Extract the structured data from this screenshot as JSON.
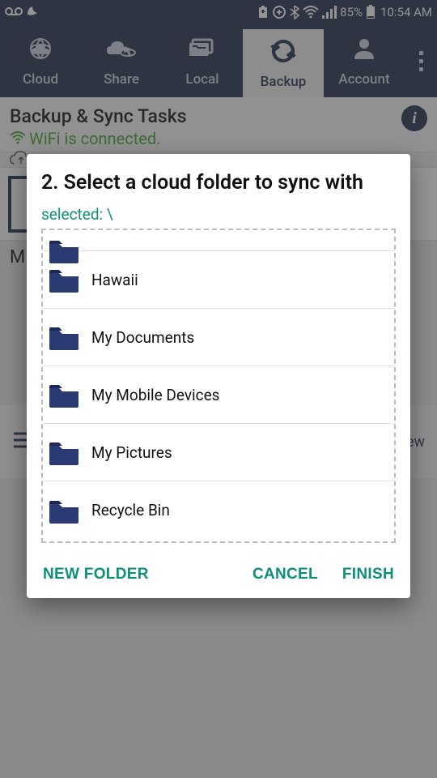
{
  "status": {
    "battery": "85%",
    "time": "10:54 AM"
  },
  "nav": {
    "tabs": [
      {
        "label": "Cloud"
      },
      {
        "label": "Share"
      },
      {
        "label": "Local"
      },
      {
        "label": "Backup"
      },
      {
        "label": "Account"
      }
    ],
    "active_index": 3
  },
  "page": {
    "title": "Backup & Sync Tasks",
    "wifi_status": "WiFi is connected."
  },
  "bg": {
    "row_letter": "M",
    "strip_text": "ew"
  },
  "dialog": {
    "title": "2. Select a cloud folder to sync with",
    "selected_prefix": "selected: ",
    "selected_path": "\\",
    "folders": [
      {
        "name": "Hawaii"
      },
      {
        "name": "My Documents"
      },
      {
        "name": "My Mobile Devices"
      },
      {
        "name": "My Pictures"
      },
      {
        "name": "Recycle Bin"
      }
    ],
    "buttons": {
      "new_folder": "NEW FOLDER",
      "cancel": "CANCEL",
      "finish": "FINISH"
    }
  }
}
